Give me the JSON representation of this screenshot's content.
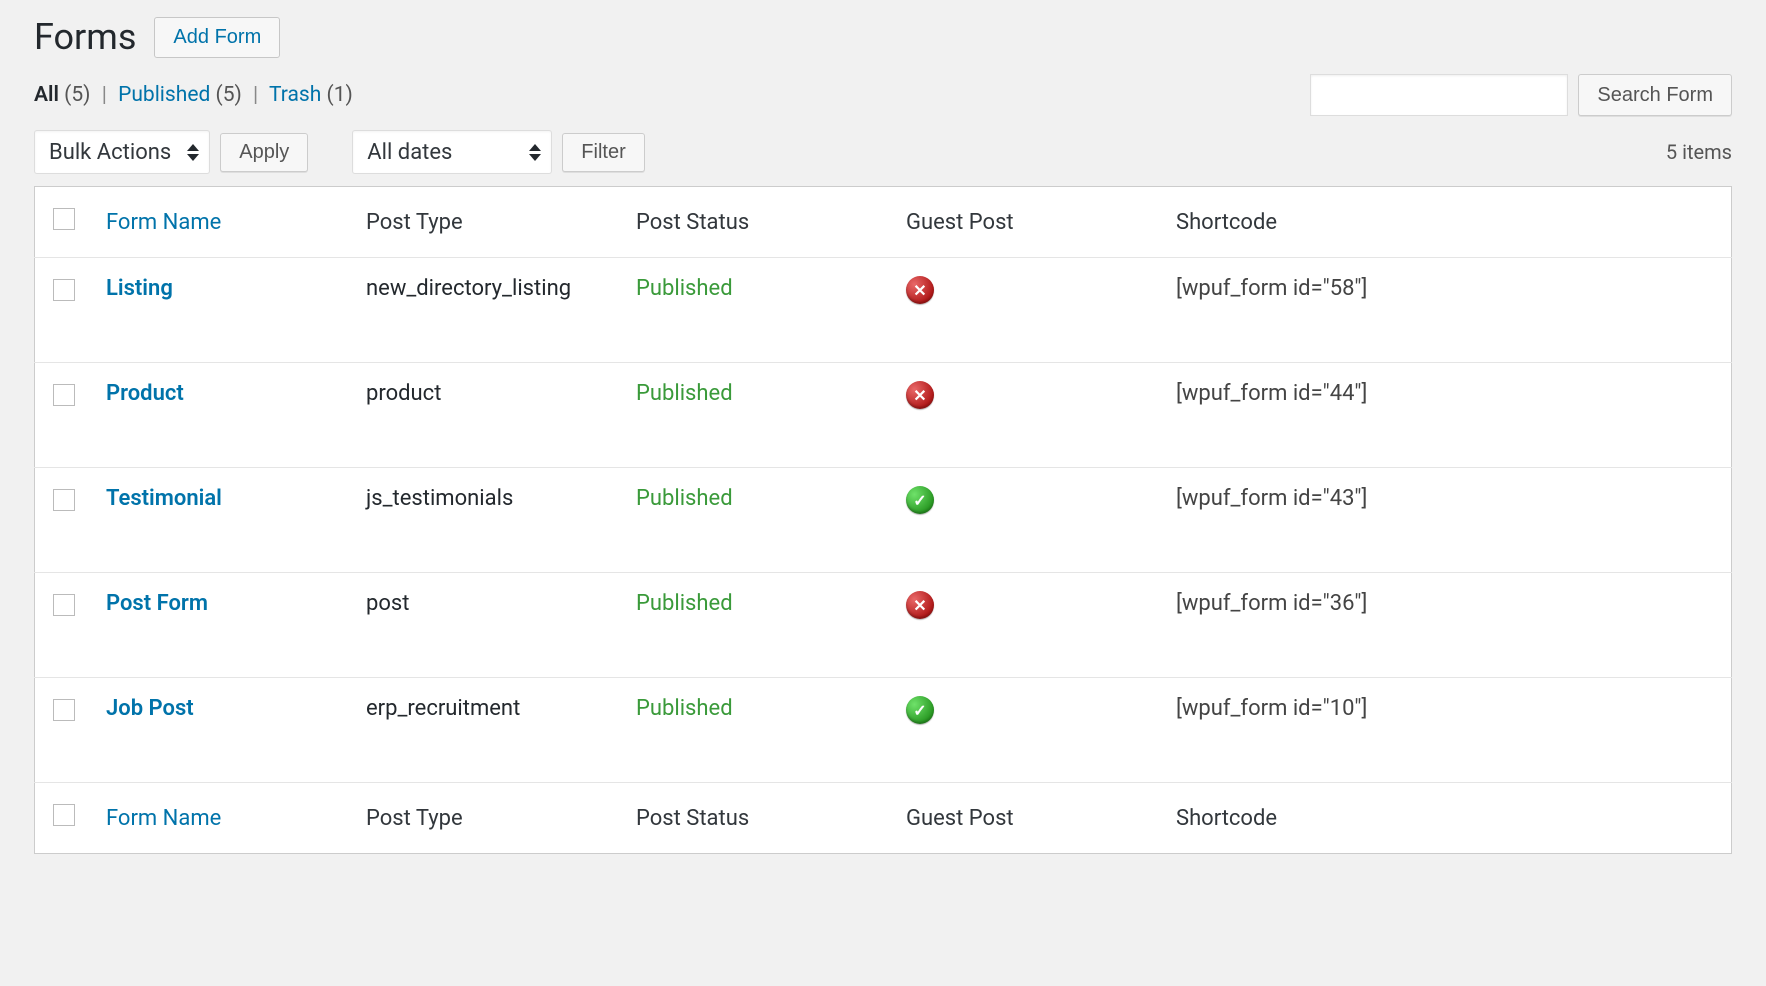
{
  "header": {
    "title": "Forms",
    "add_label": "Add Form"
  },
  "subsub": {
    "all_label": "All",
    "all_count": "(5)",
    "published_label": "Published",
    "published_count": "(5)",
    "trash_label": "Trash",
    "trash_count": "(1)"
  },
  "search": {
    "button_label": "Search Form"
  },
  "filters": {
    "bulk_label": "Bulk Actions",
    "apply_label": "Apply",
    "dates_label": "All dates",
    "filter_label": "Filter",
    "items_count": "5 items"
  },
  "columns": {
    "form_name": "Form Name",
    "post_type": "Post Type",
    "post_status": "Post Status",
    "guest_post": "Guest Post",
    "shortcode": "Shortcode"
  },
  "rows": [
    {
      "name": "Listing",
      "post_type": "new_directory_listing",
      "status": "Published",
      "guest": false,
      "shortcode": "[wpuf_form id=\"58\"]"
    },
    {
      "name": "Product",
      "post_type": "product",
      "status": "Published",
      "guest": false,
      "shortcode": "[wpuf_form id=\"44\"]"
    },
    {
      "name": "Testimonial",
      "post_type": "js_testimonials",
      "status": "Published",
      "guest": true,
      "shortcode": "[wpuf_form id=\"43\"]"
    },
    {
      "name": "Post Form",
      "post_type": "post",
      "status": "Published",
      "guest": false,
      "shortcode": "[wpuf_form id=\"36\"]"
    },
    {
      "name": "Job Post",
      "post_type": "erp_recruitment",
      "status": "Published",
      "guest": true,
      "shortcode": "[wpuf_form id=\"10\"]"
    }
  ]
}
